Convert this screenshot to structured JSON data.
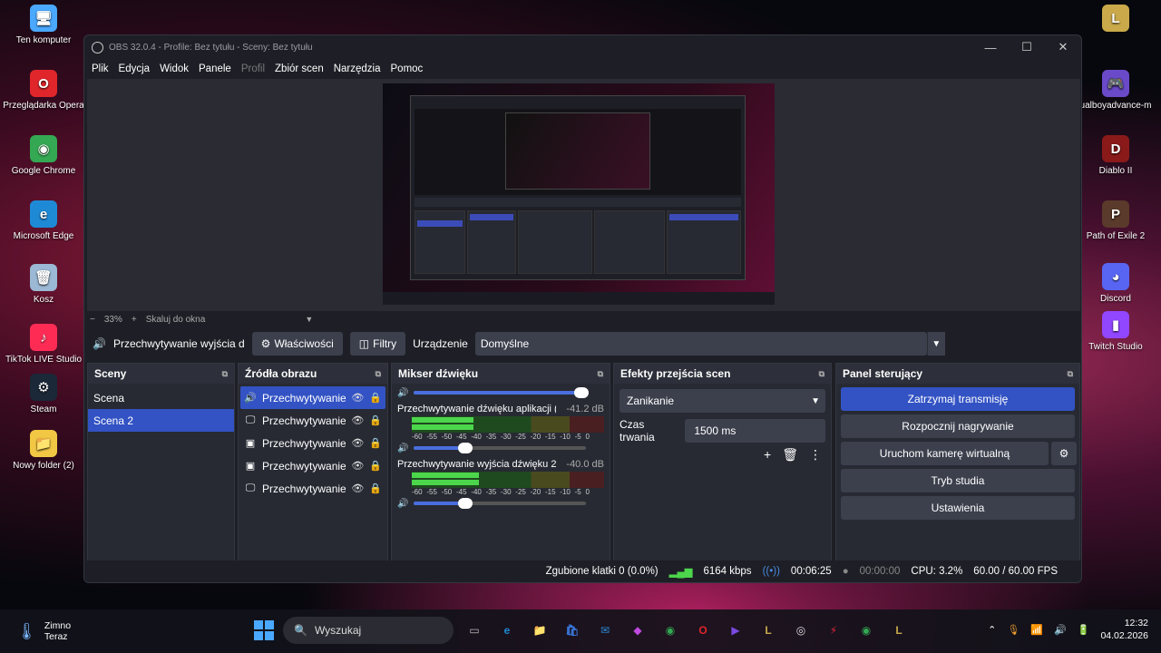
{
  "desktop": {
    "left_icons": [
      {
        "label": "Ten komputer",
        "icon": "computer-icon",
        "color": "#4aa8ff"
      },
      {
        "label": "Przeglądarka Opera",
        "icon": "opera-icon",
        "color": "#e0262b"
      },
      {
        "label": "Google Chrome",
        "icon": "chrome-icon",
        "color": "#34a853"
      },
      {
        "label": "Microsoft Edge",
        "icon": "edge-icon",
        "color": "#1e8ad6"
      },
      {
        "label": "Kosz",
        "icon": "recycle-bin-icon",
        "color": "#9bb8d4"
      },
      {
        "label": "TikTok LIVE Studio",
        "icon": "tiktok-icon",
        "color": "#fe2c55"
      },
      {
        "label": "Steam",
        "icon": "steam-icon",
        "color": "#1b2838"
      },
      {
        "label": "Nowy folder (2)",
        "icon": "folder-icon",
        "color": "#f2c744"
      }
    ],
    "right_icons": [
      {
        "label": "",
        "icon": "league-icon",
        "color": "#c9a94a"
      },
      {
        "label": "ualboyadvance-m",
        "icon": "gamepad-icon",
        "color": "#6a4ac9"
      },
      {
        "label": "Diablo II",
        "icon": "diablo-icon",
        "color": "#8a1a1a"
      },
      {
        "label": "Path of Exile 2",
        "icon": "poe-icon",
        "color": "#5a3a2a"
      },
      {
        "label": "Discord",
        "icon": "discord-icon",
        "color": "#5865f2"
      },
      {
        "label": "Twitch Studio",
        "icon": "twitch-icon",
        "color": "#9146ff"
      }
    ]
  },
  "obs": {
    "title": "OBS 32.0.4 - Profile: Bez tytułu - Sceny: Bez tytułu",
    "menu": [
      "Plik",
      "Edycja",
      "Widok",
      "Panele",
      "Profil",
      "Zbiór scen",
      "Narzędzia",
      "Pomoc"
    ],
    "zoom": {
      "minus": "−",
      "value": "33%",
      "plus": "+",
      "fit": "Skaluj do okna"
    },
    "source_bar": {
      "source_name": "Przechwytywanie wyjścia d",
      "properties": "Właściwości",
      "filters": "Filtry",
      "device_label": "Urządzenie",
      "device_value": "Domyślne"
    },
    "scenes": {
      "title": "Sceny",
      "items": [
        {
          "label": "Scena",
          "selected": false
        },
        {
          "label": "Scena 2",
          "selected": true
        }
      ]
    },
    "sources": {
      "title": "Źródła obrazu",
      "items": [
        {
          "label": "Przechwytywanie",
          "icon": "speaker-icon",
          "selected": true
        },
        {
          "label": "Przechwytywanie",
          "icon": "monitor-icon",
          "selected": false
        },
        {
          "label": "Przechwytywanie",
          "icon": "window-capture-icon",
          "selected": false
        },
        {
          "label": "Przechwytywanie",
          "icon": "window-capture-icon",
          "selected": false
        },
        {
          "label": "Przechwytywanie",
          "icon": "monitor-icon",
          "selected": false
        }
      ]
    },
    "mixer": {
      "title": "Mikser dźwięku",
      "scale": [
        "-60",
        "-55",
        "-50",
        "-45",
        "-40",
        "-35",
        "-30",
        "-25",
        "-20",
        "-15",
        "-10",
        "-5",
        "0"
      ],
      "channels": [
        {
          "name": "",
          "db": "",
          "level": 0.97,
          "meter": 0.0
        },
        {
          "name": "Przechwytywanie dźwięku aplikacji (BETA",
          "db": "-41.2 dB",
          "level": 0.3,
          "meter": 0.32
        },
        {
          "name": "Przechwytywanie wyjścia dźwięku 2",
          "db": "-40.0 dB",
          "level": 0.3,
          "meter": 0.35
        }
      ]
    },
    "transitions": {
      "title": "Efekty przejścia scen",
      "selected": "Zanikanie",
      "duration_label": "Czas trwania",
      "duration_value": "1500 ms"
    },
    "controls": {
      "title": "Panel sterujący",
      "stop_stream": "Zatrzymaj transmisję",
      "start_recording": "Rozpocznij nagrywanie",
      "virtual_cam": "Uruchom kamerę wirtualną",
      "studio_mode": "Tryb studia",
      "settings": "Ustawienia"
    },
    "status": {
      "dropped": "Zgubione klatki 0 (0.0%)",
      "bitrate": "6164 kbps",
      "stream_time": "00:06:25",
      "rec_time": "00:00:00",
      "cpu": "CPU: 3.2%",
      "fps": "60.00 / 60.00 FPS"
    }
  },
  "taskbar": {
    "weather_title": "Zimno",
    "weather_sub": "Teraz",
    "search_placeholder": "Wyszukaj",
    "apps": [
      {
        "icon": "task-view-icon",
        "color": "#bbbbbb"
      },
      {
        "icon": "edge-icon",
        "color": "#1e8ad6"
      },
      {
        "icon": "explorer-icon",
        "color": "#f2c744"
      },
      {
        "icon": "store-icon",
        "color": "#3a7ae0"
      },
      {
        "icon": "mail-icon",
        "color": "#2a8ad6"
      },
      {
        "icon": "m365-icon",
        "color": "#c04ae0"
      },
      {
        "icon": "chrome-icon",
        "color": "#34a853"
      },
      {
        "icon": "opera-icon",
        "color": "#e0262b"
      },
      {
        "icon": "clipchamp-icon",
        "color": "#7a4ae0"
      },
      {
        "icon": "league-icon",
        "color": "#c9a94a"
      },
      {
        "icon": "obs-icon",
        "color": "#dddddd"
      },
      {
        "icon": "thunder-icon",
        "color": "#e0263a"
      },
      {
        "icon": "chrome-profile-icon",
        "color": "#34a853"
      },
      {
        "icon": "league-client-icon",
        "color": "#c9a94a"
      }
    ],
    "time": "12:32",
    "date": "04.02.2026"
  }
}
